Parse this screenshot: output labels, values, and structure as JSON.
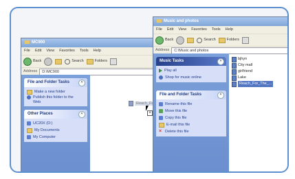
{
  "left_window": {
    "title": "MC900",
    "menu": [
      "File",
      "Edit",
      "View",
      "Favorites",
      "Tools",
      "Help"
    ],
    "toolbar": {
      "back": "Back",
      "search": "Search",
      "folders": "Folders"
    },
    "address_label": "Address",
    "address_value": "D:\\MC900",
    "file_folder_tasks": {
      "title": "File and Folder Tasks",
      "items": [
        "Make a new folder",
        "Publish this folder to the Web"
      ]
    },
    "other_places": {
      "title": "Other Places",
      "items": [
        "UC20X (D:)",
        "My Documents",
        "My Computer"
      ]
    }
  },
  "right_window": {
    "title": "Music and photos",
    "menu": [
      "File",
      "Edit",
      "View",
      "Favorites",
      "Tools",
      "Help"
    ],
    "toolbar": {
      "back": "Back",
      "search": "Search",
      "folders": "Folders"
    },
    "address_label": "Address",
    "address_value": "C:\\Music and photos",
    "music_tasks": {
      "title": "Music Tasks",
      "items": [
        "Play all",
        "Shop for music online"
      ]
    },
    "file_folder_tasks": {
      "title": "File and Folder Tasks",
      "items": [
        "Rename this file",
        "Move this file",
        "Copy this file",
        "E-mail this file",
        "Delete this file"
      ]
    },
    "files": [
      "bjhyn",
      "City mall",
      "girlfriend",
      "Lake",
      "Reach_For_The_..."
    ]
  },
  "drag": {
    "label": "Reach_For_The_..."
  }
}
